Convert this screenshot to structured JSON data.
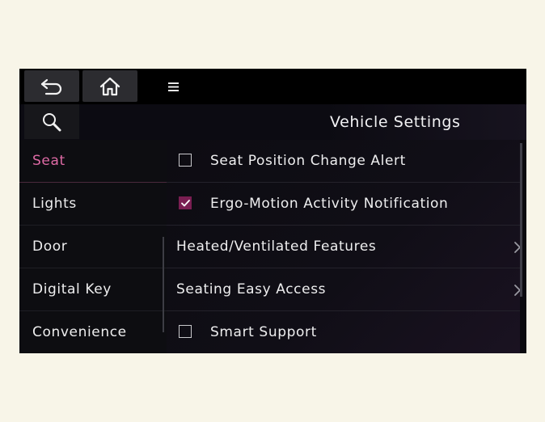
{
  "header": {
    "title": "Vehicle Settings",
    "back_icon": "back-arrow-icon",
    "home_icon": "home-icon",
    "menu_icon": "menu-icon",
    "search_icon": "search-icon"
  },
  "sidebar": {
    "items": [
      {
        "label": "Seat",
        "active": true
      },
      {
        "label": "Lights",
        "active": false
      },
      {
        "label": "Door",
        "active": false
      },
      {
        "label": "Digital Key",
        "active": false
      },
      {
        "label": "Convenience",
        "active": false
      }
    ]
  },
  "settings": {
    "items": [
      {
        "label": "Seat Position Change Alert",
        "type": "checkbox",
        "checked": false
      },
      {
        "label": "Ergo-Motion Activity Notification",
        "type": "checkbox",
        "checked": true
      },
      {
        "label": "Heated/Ventilated Features",
        "type": "submenu"
      },
      {
        "label": "Seating Easy Access",
        "type": "submenu"
      },
      {
        "label": "Smart Support",
        "type": "checkbox",
        "checked": false
      }
    ]
  },
  "colors": {
    "accent": "#de6aa5",
    "checked_box": "#7a1e52",
    "background": "#0b0a0f",
    "page": "#f8f5e8"
  }
}
